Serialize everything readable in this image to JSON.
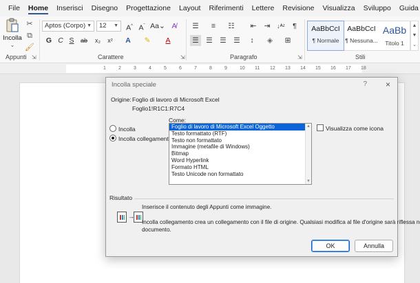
{
  "menu": {
    "tabs": [
      "File",
      "Home",
      "Inserisci",
      "Disegno",
      "Progettazione",
      "Layout",
      "Riferimenti",
      "Lettere",
      "Revisione",
      "Visualizza",
      "Sviluppo",
      "Guida"
    ],
    "active": "Home"
  },
  "ribbon": {
    "clipboard": {
      "paste_label": "Incolla",
      "group_label": "Appunti"
    },
    "font": {
      "group_label": "Carattere",
      "font_name": "Aptos (Corpo)",
      "font_size": "12",
      "bold": "G",
      "italic": "C",
      "underline": "S",
      "strike": "ab",
      "sub": "x₂",
      "sup": "x²"
    },
    "paragraph": {
      "group_label": "Paragrafo"
    },
    "styles": {
      "group_label": "Stili",
      "items": [
        {
          "sample": "AaBbCcI",
          "name": "¶ Normale"
        },
        {
          "sample": "AaBbCcI",
          "name": "¶ Nessuna..."
        },
        {
          "sample": "AaBb",
          "name": "Titolo 1"
        }
      ]
    }
  },
  "ruler": {
    "ticks": [
      "1",
      "2",
      "3",
      "4",
      "5",
      "6",
      "7",
      "8",
      "9",
      "10",
      "11",
      "12",
      "13",
      "14",
      "15",
      "16",
      "17",
      "18"
    ]
  },
  "dialog": {
    "title": "Incolla speciale",
    "help": "?",
    "close": "×",
    "origin_label": "Origine:",
    "origin_value": "Foglio di lavoro di Microsoft Excel",
    "origin_range": "Foglio1!R1C1:R7C4",
    "as_label": "Come:",
    "paste_option": "Incolla",
    "paste_link_option": "Incolla collegamento",
    "show_as_icon": "Visualizza come icona",
    "formats": [
      "Foglio di lavoro di Microsoft Excel Oggetto",
      "Testo formattato (RTF)",
      "Testo non formattato",
      "Immagine (metafile di Windows)",
      "Bitmap",
      "Word Hyperlink",
      "Formato HTML",
      "Testo Unicode non formattato"
    ],
    "result_label": "Risultato",
    "result_line1": "Inserisce il contenuto degli Appunti come immagine.",
    "result_line2": "Incolla collegamento crea un collegamento con il file di origine. Qualsiasi modifica al file d'origine sarà riflessa nel",
    "result_line3": "documento.",
    "ok": "OK",
    "cancel": "Annulla"
  }
}
